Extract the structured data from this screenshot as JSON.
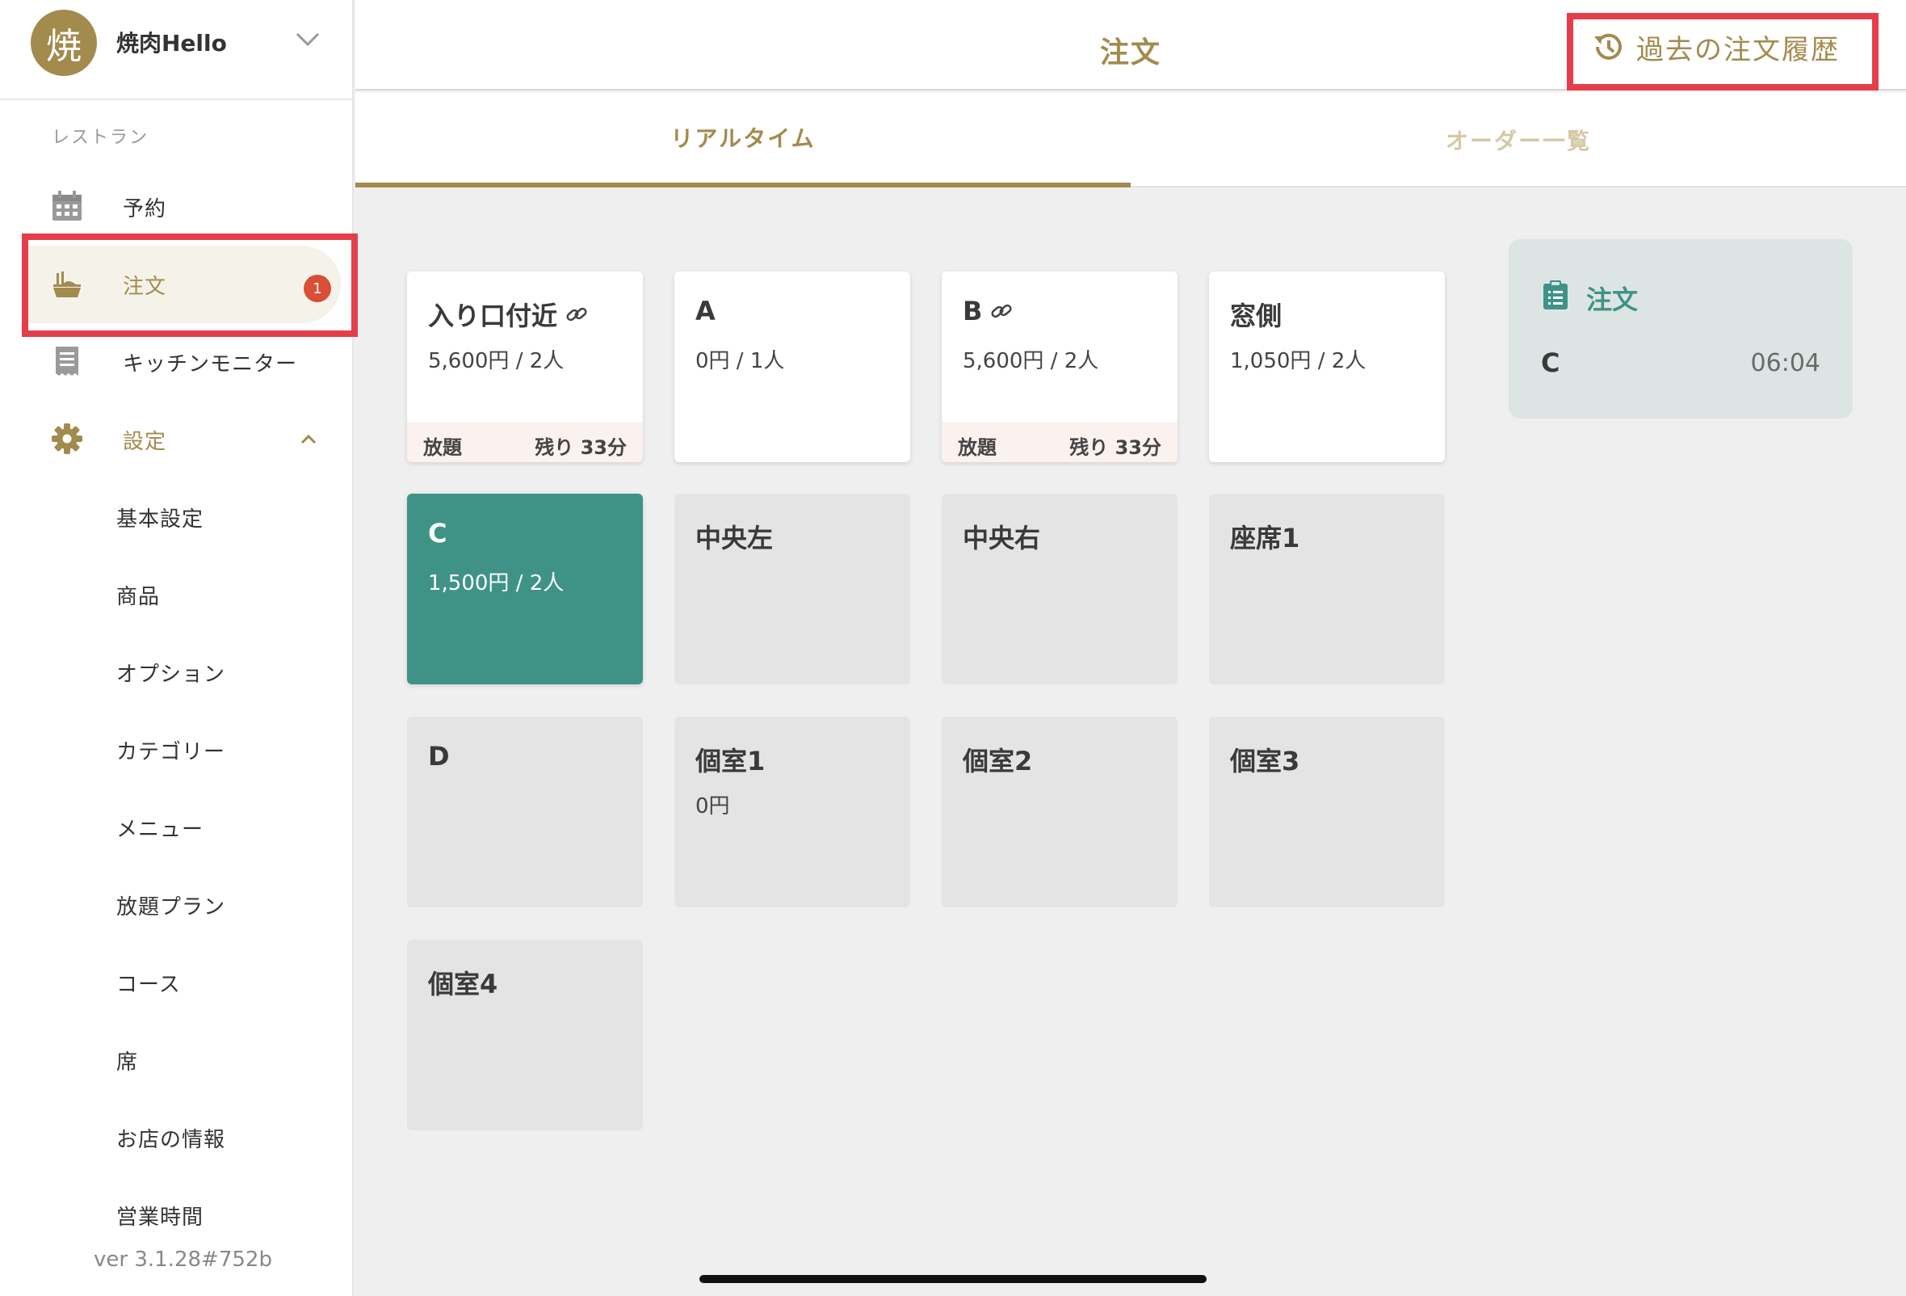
{
  "sidebar": {
    "logo_char": "焼",
    "store_name": "焼肉Hello",
    "section_label": "レストラン",
    "nav": [
      {
        "label": "予約"
      },
      {
        "label": "注文",
        "badge": "1"
      },
      {
        "label": "キッチンモニター"
      },
      {
        "label": "設定"
      }
    ],
    "settings_items": [
      "基本設定",
      "商品",
      "オプション",
      "カテゴリー",
      "メニュー",
      "放題プラン",
      "コース",
      "席",
      "お店の情報",
      "営業時間"
    ],
    "version": "ver 3.1.28#752b"
  },
  "header": {
    "title": "注文",
    "history_button": "過去の注文履歴"
  },
  "tabs": [
    {
      "label": "リアルタイム"
    },
    {
      "label": "オーダー一覧"
    }
  ],
  "tables": [
    {
      "name": "入り口付近",
      "info": "5,600円 / 2人",
      "plan": "放題",
      "remaining": "残り 33分"
    },
    {
      "name": "A",
      "info": "0円 / 1人"
    },
    {
      "name": "B",
      "info": "5,600円 / 2人",
      "plan": "放題",
      "remaining": "残り 33分"
    },
    {
      "name": "窓側",
      "info": "1,050円 / 2人"
    },
    {
      "name": "C",
      "info": "1,500円 / 2人"
    },
    {
      "name": "中央左"
    },
    {
      "name": "中央右"
    },
    {
      "name": "座席1"
    },
    {
      "name": "D"
    },
    {
      "name": "個室1",
      "info": "0円"
    },
    {
      "name": "個室2"
    },
    {
      "name": "個室3"
    },
    {
      "name": "個室4"
    }
  ],
  "order_panel": {
    "title": "注文",
    "rows": [
      {
        "table": "C",
        "time": "06:04"
      }
    ]
  },
  "colors": {
    "gold_accent": "#a38b4e",
    "teal_selected": "#3f9386",
    "badge_red": "#d94e36",
    "highlight_red": "#e53e4b"
  }
}
